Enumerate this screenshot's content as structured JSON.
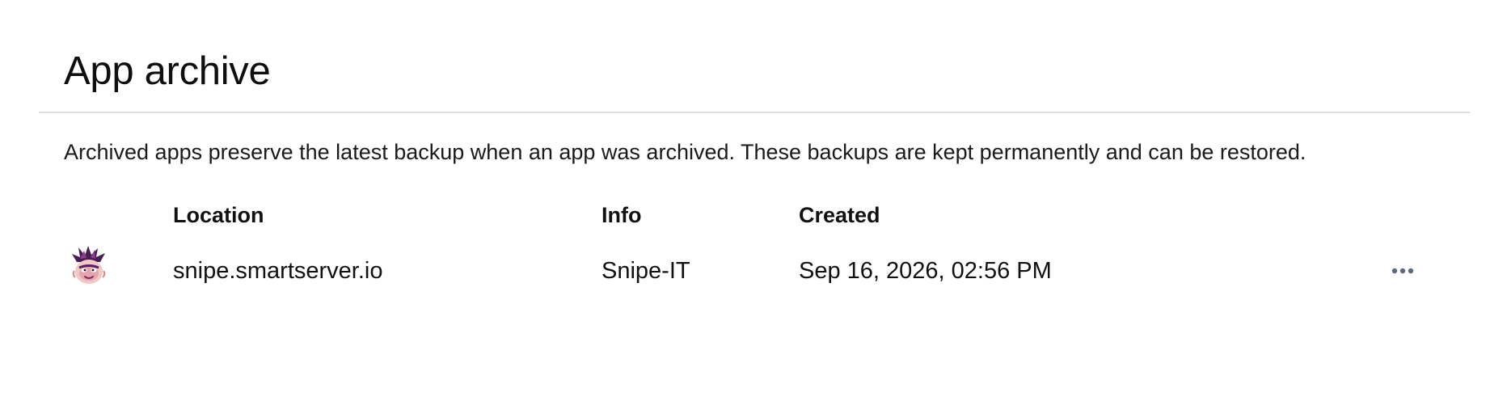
{
  "page": {
    "title": "App archive",
    "description": "Archived apps preserve the latest backup when an app was archived. These backups are kept permanently and can be restored."
  },
  "table": {
    "columns": [
      "Location",
      "Info",
      "Created"
    ],
    "rows": [
      {
        "icon": "snipe-it-app-icon",
        "location": "snipe.smartserver.io",
        "info": "Snipe-IT",
        "created": "Sep 16, 2026, 02:56 PM",
        "actions_icon": "more-horizontal-icon"
      }
    ]
  },
  "colors": {
    "text": "#111111",
    "divider": "#dedede",
    "actions": "#5f6b7a"
  }
}
